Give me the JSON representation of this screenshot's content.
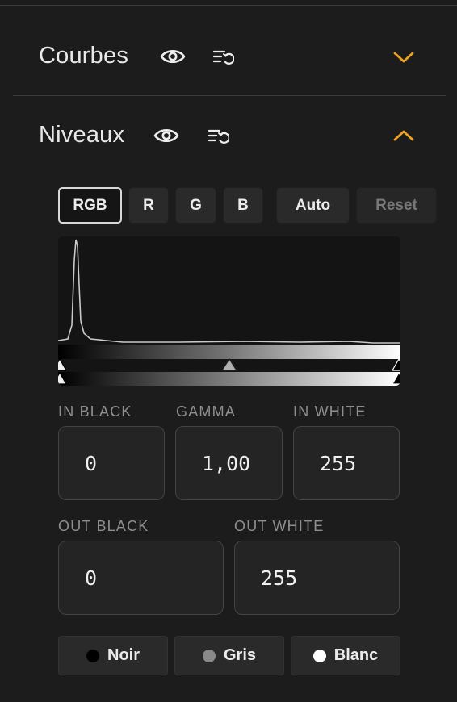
{
  "panels": {
    "curves": {
      "title": "Courbes"
    },
    "levels": {
      "title": "Niveaux"
    }
  },
  "channels": {
    "rgb": "RGB",
    "r": "R",
    "g": "G",
    "b": "B",
    "auto": "Auto",
    "reset": "Reset"
  },
  "inputs": {
    "in_black": {
      "label": "IN BLACK",
      "value": "0"
    },
    "gamma": {
      "label": "GAMMA",
      "value": "1,00"
    },
    "in_white": {
      "label": "IN WHITE",
      "value": "255"
    },
    "out_black": {
      "label": "OUT BLACK",
      "value": "0"
    },
    "out_white": {
      "label": "OUT WHITE",
      "value": "255"
    }
  },
  "pickers": {
    "black": "Noir",
    "gray": "Gris",
    "white": "Blanc"
  },
  "colors": {
    "accent": "#f0a11f",
    "background": "#1c1c1c"
  },
  "icons": {
    "visibility": "eye-icon",
    "history": "history-list-icon",
    "collapse": "chevron-up-icon",
    "expand": "chevron-down-icon"
  }
}
